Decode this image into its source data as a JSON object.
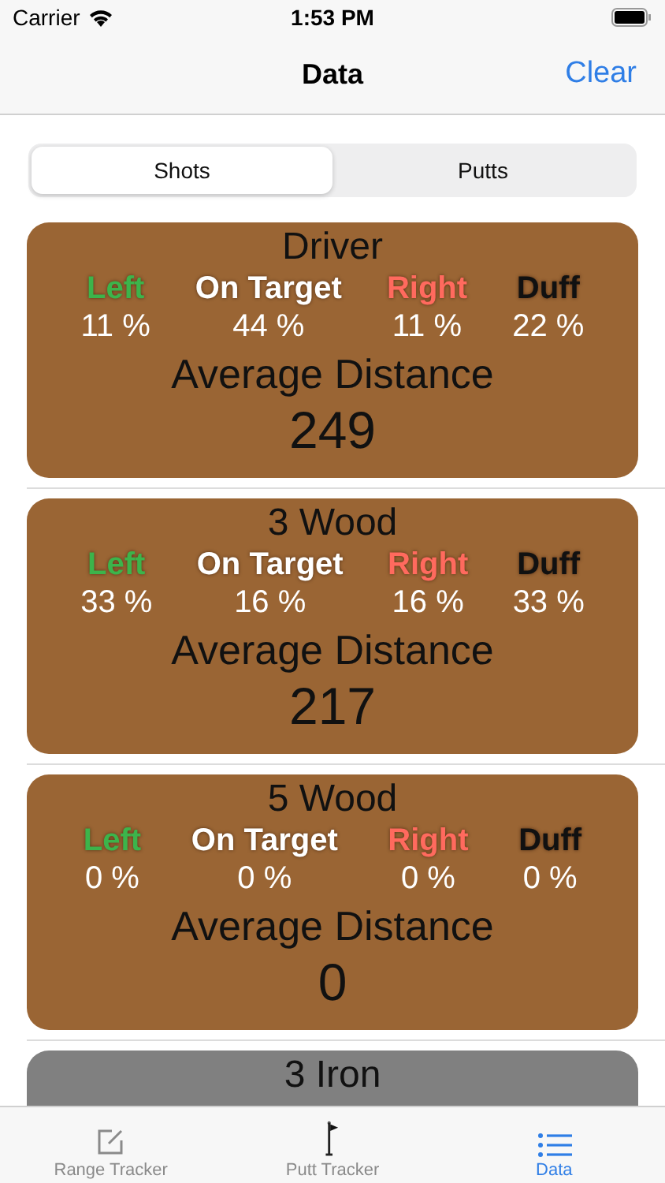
{
  "status_bar": {
    "carrier": "Carrier",
    "time": "1:53 PM"
  },
  "nav": {
    "title": "Data",
    "action": "Clear"
  },
  "segments": [
    {
      "label": "Shots",
      "selected": true
    },
    {
      "label": "Putts",
      "selected": false
    }
  ],
  "cards": [
    {
      "name": "Driver",
      "color": "#9a6534",
      "stats": [
        {
          "label": "Left",
          "value": "11 %",
          "color": "#3cb44b"
        },
        {
          "label": "On Target",
          "value": "44 %",
          "color": "#ffffff"
        },
        {
          "label": "Right",
          "value": "11 %",
          "color": "#ff6a5e"
        },
        {
          "label": "Duff",
          "value": "22 %",
          "color": "#111111"
        }
      ],
      "average_label": "Average Distance",
      "average": "249"
    },
    {
      "name": "3 Wood",
      "color": "#9a6534",
      "stats": [
        {
          "label": "Left",
          "value": "33 %",
          "color": "#3cb44b"
        },
        {
          "label": "On Target",
          "value": "16 %",
          "color": "#ffffff"
        },
        {
          "label": "Right",
          "value": "16 %",
          "color": "#ff6a5e"
        },
        {
          "label": "Duff",
          "value": "33 %",
          "color": "#111111"
        }
      ],
      "average_label": "Average Distance",
      "average": "217"
    },
    {
      "name": "5 Wood",
      "color": "#9a6534",
      "stats": [
        {
          "label": "Left",
          "value": "0 %",
          "color": "#3cb44b"
        },
        {
          "label": "On Target",
          "value": "0 %",
          "color": "#ffffff"
        },
        {
          "label": "Right",
          "value": "0 %",
          "color": "#ff6a5e"
        },
        {
          "label": "Duff",
          "value": "0 %",
          "color": "#111111"
        }
      ],
      "average_label": "Average Distance",
      "average": "0"
    },
    {
      "name": "3 Iron",
      "color": "#808080"
    }
  ],
  "tab_bar": [
    {
      "label": "Range Tracker",
      "kind": "edit",
      "selected": false
    },
    {
      "label": "Putt Tracker",
      "kind": "flag",
      "selected": false
    },
    {
      "label": "Data",
      "kind": "list",
      "selected": true
    }
  ]
}
